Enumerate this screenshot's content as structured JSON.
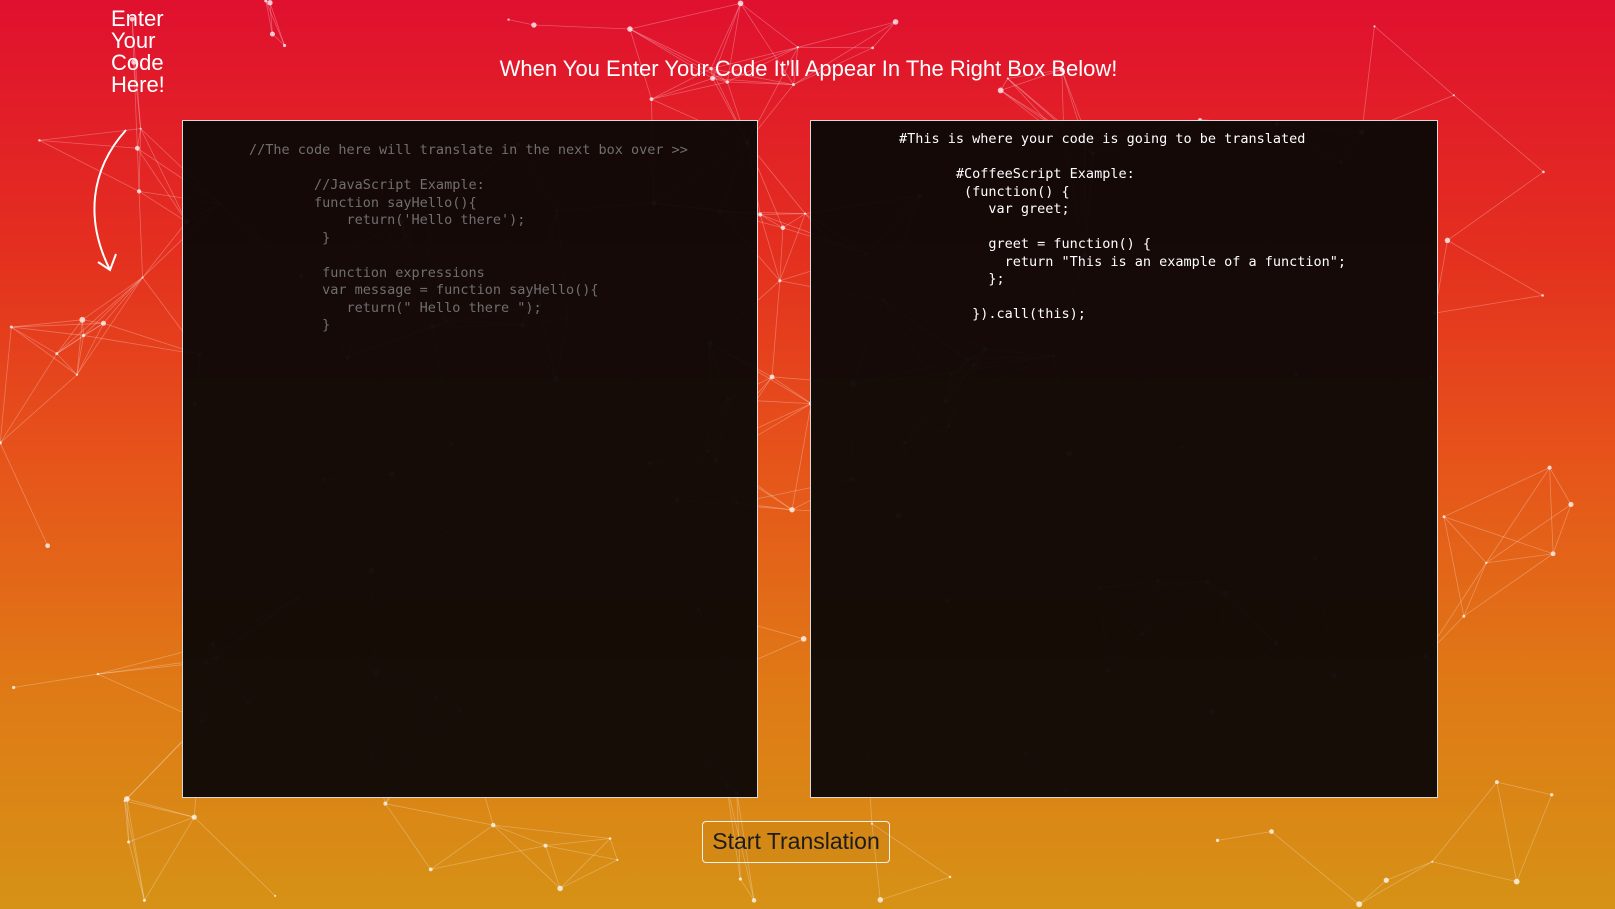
{
  "side_hint": {
    "lines": [
      "Enter",
      "Your",
      "Code",
      "Here!"
    ]
  },
  "headline": "When You Enter Your Code It'll Appear In The Right Box Below!",
  "input_editor": {
    "content": "//The code here will translate in the next box over >>\n\n        //JavaScript Example:\n        function sayHello(){\n            return('Hello there');\n         }\n\n         function expressions\n         var message = function sayHello(){\n            return(\" Hello there \");\n         }"
  },
  "output_editor": {
    "content": "#This is where your code is going to be translated\n\n       #CoffeeScript Example:\n        (function() {\n           var greet;\n\n           greet = function() {\n             return \"This is an example of a function\";\n           };\n\n         }).call(this);"
  },
  "start_button_label": "Start Translation",
  "colors": {
    "gradient_top": "#e0102f",
    "gradient_bottom": "#d69216",
    "editor_bg": "#0c0806",
    "input_text": "#6f6f6f",
    "output_text": "#ffffff"
  },
  "icons": [
    "curved-arrow-icon"
  ]
}
